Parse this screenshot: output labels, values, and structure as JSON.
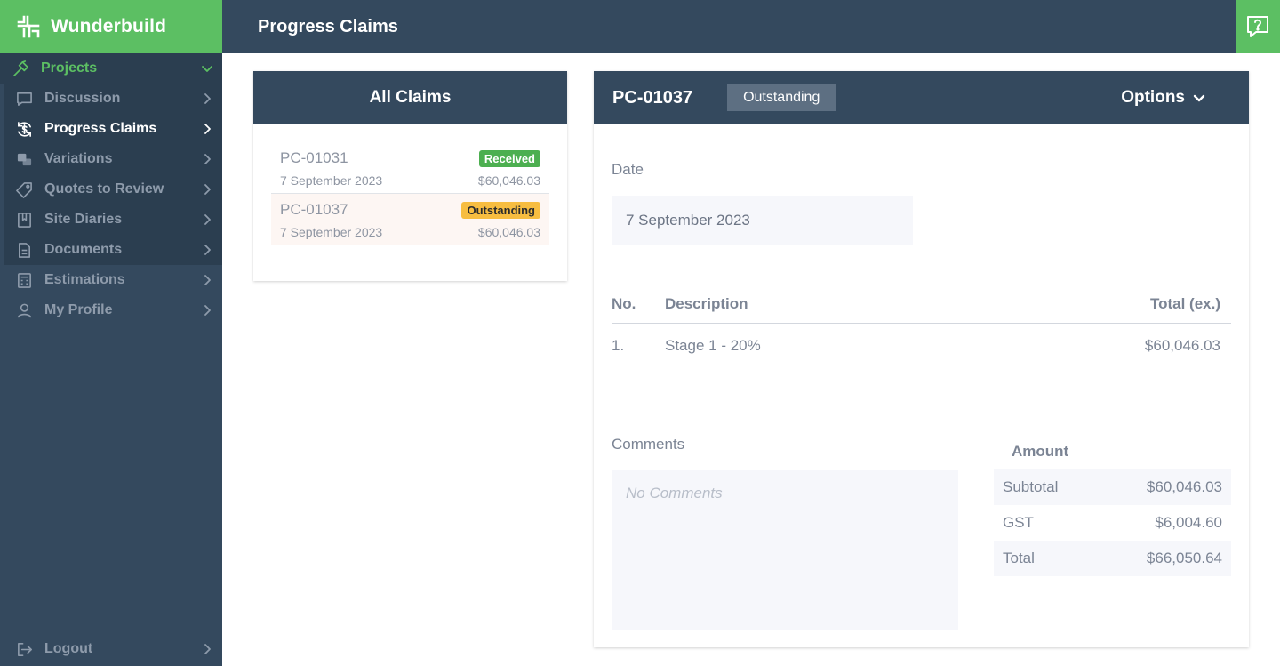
{
  "brand": {
    "name": "Wunderbuild"
  },
  "header": {
    "title": "Progress Claims"
  },
  "sidebar": {
    "projects_label": "Projects",
    "items": [
      {
        "label": "Discussion"
      },
      {
        "label": "Progress Claims"
      },
      {
        "label": "Variations"
      },
      {
        "label": "Quotes to Review"
      },
      {
        "label": "Site Diaries"
      },
      {
        "label": "Documents"
      }
    ],
    "plain_items": [
      {
        "label": "Estimations"
      },
      {
        "label": "My Profile"
      }
    ],
    "logout_label": "Logout"
  },
  "claims": {
    "title": "All Claims",
    "rows": [
      {
        "id": "PC-01031",
        "status": "Received",
        "date": "7 September 2023",
        "amount": "$60,046.03"
      },
      {
        "id": "PC-01037",
        "status": "Outstanding",
        "date": "7 September 2023",
        "amount": "$60,046.03"
      }
    ]
  },
  "detail": {
    "id": "PC-01037",
    "status": "Outstanding",
    "options_label": "Options",
    "date_label": "Date",
    "date_value": "7 September 2023",
    "table": {
      "headers": {
        "no": "No.",
        "description": "Description",
        "total": "Total (ex.)"
      },
      "rows": [
        {
          "no": "1.",
          "description": "Stage 1 - 20%",
          "total": "$60,046.03"
        }
      ]
    },
    "comments_label": "Comments",
    "comments_placeholder": "No Comments",
    "amount": {
      "title": "Amount",
      "rows": [
        {
          "label": "Subtotal",
          "value": "$60,046.03"
        },
        {
          "label": "GST",
          "value": "$6,004.60"
        },
        {
          "label": "Total",
          "value": "$66,050.64"
        }
      ]
    }
  },
  "colors": {
    "navy": "#34495e",
    "green": "#5cbf63",
    "received": "#4caf50",
    "outstanding": "#f7bd40"
  }
}
